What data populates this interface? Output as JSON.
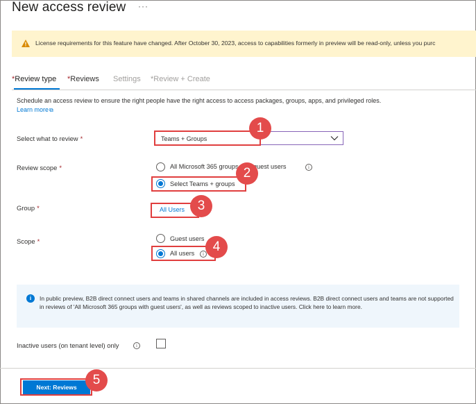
{
  "header": {
    "title": "New access review",
    "more": "···"
  },
  "banner": {
    "icon": "warning-icon",
    "text": "License requirements for this feature have changed. After October 30, 2023, access to capabilities formerly in preview will be read-only, unless you purc"
  },
  "tabs": [
    {
      "req": "*",
      "label": "Review type",
      "state": "active"
    },
    {
      "req": "*",
      "label": "Reviews",
      "state": "normal"
    },
    {
      "req": "",
      "label": "Settings",
      "state": "disabled"
    },
    {
      "req": "*",
      "label": "Review + Create",
      "state": "disabled"
    }
  ],
  "description": "Schedule an access review to ensure the right people have the right access to access packages, groups, apps, and privileged roles.",
  "learn_more": {
    "label": "Learn more",
    "icon": "external-link-icon",
    "glyph": "⧉"
  },
  "form": {
    "select_label": "Select what to review",
    "select_value": "Teams + Groups",
    "review_scope_label": "Review scope",
    "review_scope_options": [
      "All Microsoft 365 groups with guest users",
      "Select Teams + groups"
    ],
    "review_scope_selected": 1,
    "group_label": "Group",
    "group_link": "All Users",
    "scope_label": "Scope",
    "scope_options": [
      "Guest users",
      "All users"
    ],
    "scope_selected": 1,
    "info_glyph": "i",
    "required": "*"
  },
  "info_box": {
    "icon": "info-icon",
    "text": "In public preview, B2B direct connect users and teams in shared channels are included in access reviews. B2B direct connect users and teams are not supported in reviews of 'All Microsoft 365 groups with guest users', as well as reviews scoped to inactive users. Click here to learn more."
  },
  "inactive": {
    "label": "Inactive users (on tenant level) only",
    "checked": false
  },
  "footer": {
    "next_label": "Next: Reviews"
  },
  "callouts": [
    "1",
    "2",
    "3",
    "4",
    "5"
  ],
  "colors": {
    "accent": "#0078d4",
    "highlight": "#e03e3e",
    "callout": "#e34b4b",
    "warning_bg": "#fff4ce",
    "info_bg": "#eff6fc"
  }
}
